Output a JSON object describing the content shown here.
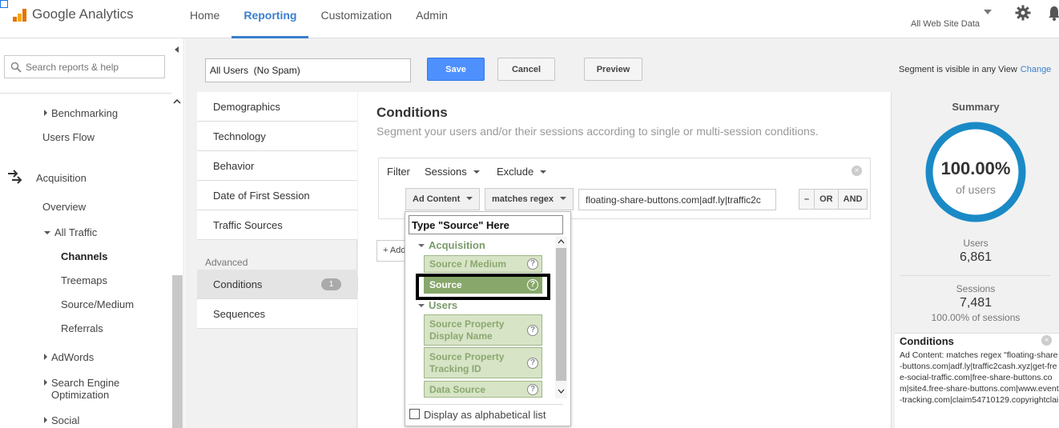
{
  "app": {
    "name": "Google Analytics"
  },
  "nav": {
    "items": [
      {
        "label": "Home"
      },
      {
        "label": "Reporting"
      },
      {
        "label": "Customization"
      },
      {
        "label": "Admin"
      }
    ]
  },
  "account": {
    "view": "All Web Site Data"
  },
  "sidebar": {
    "search_placeholder": "Search reports & help",
    "benchmarking": "Benchmarking",
    "users_flow": "Users Flow",
    "acquisition": "Acquisition",
    "overview": "Overview",
    "all_traffic": "All Traffic",
    "channels": "Channels",
    "treemaps": "Treemaps",
    "source_medium": "Source/Medium",
    "referrals": "Referrals",
    "adwords": "AdWords",
    "seo_line1": "Search Engine",
    "seo_line2": "Optimization",
    "social": "Social"
  },
  "segment": {
    "name": "All Users  (No Spam)",
    "save": "Save",
    "cancel": "Cancel",
    "preview": "Preview",
    "visible_text": "Segment is visible in any View",
    "change": "Change"
  },
  "categories": {
    "items": [
      "Demographics",
      "Technology",
      "Behavior",
      "Date of First Session",
      "Traffic Sources"
    ],
    "advanced_label": "Advanced",
    "conditions": "Conditions",
    "conditions_count": "1",
    "sequences": "Sequences"
  },
  "conditions": {
    "title": "Conditions",
    "subtitle": "Segment your users and/or their sessions according to single or multi-session conditions.",
    "filter_label": "Filter",
    "scope": "Sessions",
    "mode": "Exclude",
    "dimension": "Ad Content",
    "operator": "matches regex",
    "value": "floating-share-buttons.com|adf.ly|traffic2c",
    "minus": "–",
    "or": "OR",
    "and": "AND",
    "add": "+ Add"
  },
  "picker": {
    "search_value": "Type \"Source\" Here",
    "groups": [
      {
        "label": "Acquisition"
      },
      {
        "label": "Users"
      }
    ],
    "items": [
      {
        "line1": "Source / Medium",
        "line2": ""
      },
      {
        "line1": "Source",
        "line2": ""
      },
      {
        "line1": "Source Property",
        "line2": "Display Name"
      },
      {
        "line1": "Source Property",
        "line2": "Tracking ID"
      },
      {
        "line1": "Data Source",
        "line2": ""
      }
    ],
    "help": "?",
    "alpha_label": "Display as alphabetical list"
  },
  "summary": {
    "title": "Summary",
    "percent": "100.00%",
    "percent_sub": "of users",
    "percent_fraction": 1.0,
    "users_label": "Users",
    "users_value": "6,861",
    "sessions_label": "Sessions",
    "sessions_value": "7,481",
    "sessions_pct": "100.00% of sessions",
    "ring_color": "#1a8ac6",
    "cond_title": "Conditions",
    "cond_text": "Ad Content: matches regex \"floating-share-buttons.com|adf.ly|traffic2cash.xyz|get-free-social-traffic.com|free-share-buttons.com|site4.free-share-buttons.com|www.event-tracking.com|claim54710129.copyrightclai"
  },
  "icons": {
    "close": "×"
  }
}
